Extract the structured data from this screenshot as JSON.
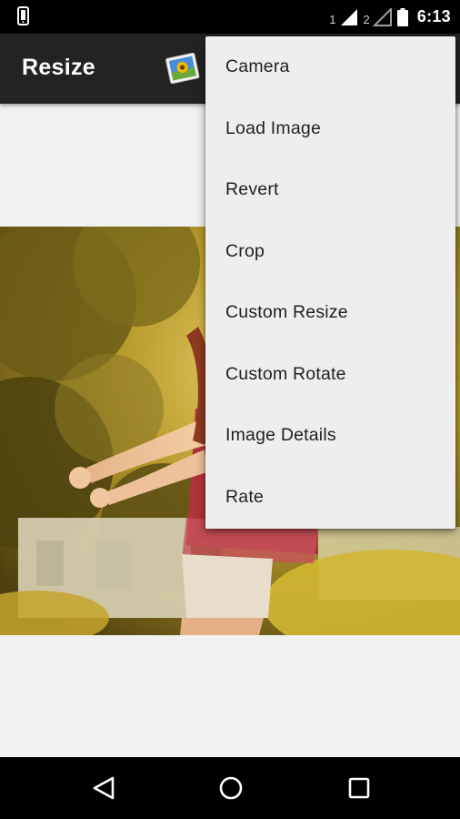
{
  "status_bar": {
    "sim1_label": "1",
    "sim2_label": "2",
    "time": "6:13",
    "icons": [
      "phone-notification-icon",
      "signal-sim1-icon",
      "signal-sim2-icon",
      "battery-icon"
    ]
  },
  "app_bar": {
    "title": "Resize",
    "gallery_icon": "gallery-icon"
  },
  "menu": {
    "items": [
      {
        "label": "Camera"
      },
      {
        "label": "Load Image"
      },
      {
        "label": "Revert"
      },
      {
        "label": "Crop"
      },
      {
        "label": "Custom Resize"
      },
      {
        "label": "Custom Rotate"
      },
      {
        "label": "Image Details"
      },
      {
        "label": "Rate"
      }
    ]
  },
  "nav_bar": {
    "icons": [
      "back-icon",
      "home-icon",
      "recents-icon"
    ]
  },
  "colors": {
    "status_bar": "#000000",
    "app_bar": "#232323",
    "menu_background": "#eeeeee",
    "content_background": "#f1f1f1"
  }
}
